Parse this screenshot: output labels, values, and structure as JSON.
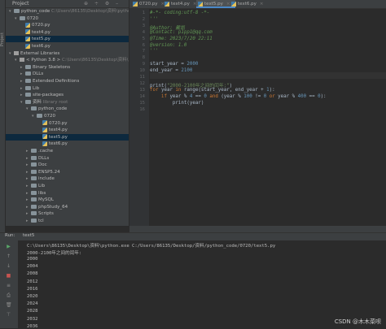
{
  "left_stripe_label": "Project",
  "project": {
    "title": "Project",
    "tools": "⊕ ÷ ⚙ –",
    "tree": [
      {
        "label": "python_code",
        "path": "C:\\Users\\86135\\Desktop\\资料\\python_c",
        "indent": 0,
        "type": "folder",
        "open": true
      },
      {
        "label": "0720",
        "path": "",
        "indent": 1,
        "type": "folder",
        "open": true
      },
      {
        "label": "0720.py",
        "path": "",
        "indent": 2,
        "type": "py"
      },
      {
        "label": "text4.py",
        "path": "",
        "indent": 2,
        "type": "py"
      },
      {
        "label": "text5.py",
        "path": "",
        "indent": 2,
        "type": "py",
        "selected": true
      },
      {
        "label": "text6.py",
        "path": "",
        "indent": 2,
        "type": "py"
      },
      {
        "label": "External Libraries",
        "path": "",
        "indent": 0,
        "type": "lib",
        "open": true
      },
      {
        "label": "< Python 3.8 >",
        "path": "C:\\Users\\86135\\Desktop\\资料\\py",
        "indent": 1,
        "type": "lib",
        "open": true
      },
      {
        "label": "Binary Skeletons",
        "path": "",
        "indent": 2,
        "type": "folder"
      },
      {
        "label": "DLLs",
        "path": "",
        "indent": 2,
        "type": "folder"
      },
      {
        "label": "Extended Definitions",
        "path": "",
        "indent": 2,
        "type": "folder"
      },
      {
        "label": "Lib",
        "path": "",
        "indent": 2,
        "type": "folder"
      },
      {
        "label": "site-packages",
        "path": "",
        "indent": 2,
        "type": "folder"
      },
      {
        "label": "资料",
        "path": "library root",
        "indent": 2,
        "type": "folder",
        "open": true
      },
      {
        "label": "python_code",
        "path": "",
        "indent": 3,
        "type": "folder",
        "open": true
      },
      {
        "label": "0720",
        "path": "",
        "indent": 4,
        "type": "folder",
        "open": true
      },
      {
        "label": "0720.py",
        "path": "",
        "indent": 5,
        "type": "py"
      },
      {
        "label": "text4.py",
        "path": "",
        "indent": 5,
        "type": "py"
      },
      {
        "label": "text5.py",
        "path": "",
        "indent": 5,
        "type": "py",
        "selected": true
      },
      {
        "label": "text6.py",
        "path": "",
        "indent": 5,
        "type": "py"
      },
      {
        "label": ".cache",
        "path": "",
        "indent": 3,
        "type": "folder"
      },
      {
        "label": "DLLs",
        "path": "",
        "indent": 3,
        "type": "folder"
      },
      {
        "label": "Doc",
        "path": "",
        "indent": 3,
        "type": "folder"
      },
      {
        "label": "ENSP5.24",
        "path": "",
        "indent": 3,
        "type": "folder"
      },
      {
        "label": "include",
        "path": "",
        "indent": 3,
        "type": "folder"
      },
      {
        "label": "Lib",
        "path": "",
        "indent": 3,
        "type": "folder"
      },
      {
        "label": "libs",
        "path": "",
        "indent": 3,
        "type": "folder"
      },
      {
        "label": "MySQL",
        "path": "",
        "indent": 3,
        "type": "folder"
      },
      {
        "label": "phpStudy_64",
        "path": "",
        "indent": 3,
        "type": "folder"
      },
      {
        "label": "Scripts",
        "path": "",
        "indent": 3,
        "type": "folder"
      },
      {
        "label": "tcl",
        "path": "",
        "indent": 3,
        "type": "folder"
      }
    ]
  },
  "tabs": [
    {
      "label": "0720.py"
    },
    {
      "label": "text4.py"
    },
    {
      "label": "text5.py",
      "active": true
    },
    {
      "label": "text6.py"
    }
  ],
  "code_lines": [
    {
      "n": "1",
      "html": "<span class='cm'>#-*- coding:utf-8 -*-</span>"
    },
    {
      "n": "2",
      "html": "<span class='cm'>'''</span>"
    },
    {
      "n": "3",
      "html": "<span class='cm'>@Author: 戴凯</span>"
    },
    {
      "n": "4",
      "html": "<span class='cm'>@Contact: p1pp1@qq.com</span>"
    },
    {
      "n": "5",
      "html": "<span class='cm'>@Time: 2023/7/20 22:11</span>"
    },
    {
      "n": "6",
      "html": "<span class='cm'>@version: 1.0</span>"
    },
    {
      "n": "7",
      "html": "<span class='cm'>'''</span>"
    },
    {
      "n": "8",
      "html": ""
    },
    {
      "n": "9",
      "html": "start_year = <span class='num'>2000</span>"
    },
    {
      "n": "10",
      "html": "end_year = <span class='num'>2100</span>"
    },
    {
      "n": "11",
      "html": ""
    },
    {
      "n": "12",
      "html": "print(<span class='str'>\"2000-2100年之间的闰年:\"</span>)"
    },
    {
      "n": "13",
      "html": "<span class='kw'>for</span> year <span class='kw'>in</span> range(start_year, end_year + <span class='num'>1</span>):"
    },
    {
      "n": "14",
      "html": "    <span class='kw'>if</span> year % <span class='num'>4</span> == <span class='num'>0</span> <span class='kw'>and</span> (year % <span class='num'>100</span> != <span class='num'>0</span> <span class='kw'>or</span> year % <span class='num'>400</span> == <span class='num'>0</span>):"
    },
    {
      "n": "15",
      "html": "        print(year)"
    },
    {
      "n": "16",
      "html": ""
    }
  ],
  "run": {
    "label": "Run:",
    "tab": "text5",
    "command": "C:\\Users\\86135\\Desktop\\资料\\python.exe C:/Users/86135/Desktop/资料/python_code/0720/text5.py",
    "header_output": "2000-2100年之间的闰年:",
    "years": [
      "2000",
      "2004",
      "2008",
      "2012",
      "2016",
      "2020",
      "2024",
      "2028",
      "2032",
      "2036"
    ]
  },
  "watermark": "CSDN @木木菜呗"
}
